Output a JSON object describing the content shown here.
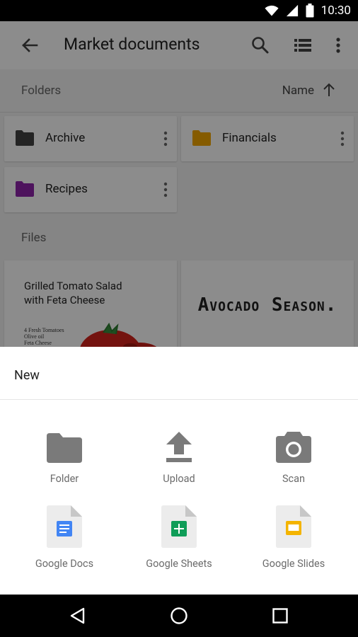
{
  "status_bar": {
    "time": "10:30"
  },
  "toolbar": {
    "title": "Market documents"
  },
  "folders_section": {
    "label": "Folders",
    "sort_label": "Name"
  },
  "folders": [
    {
      "name": "Archive",
      "color": "#424242"
    },
    {
      "name": "Financials",
      "color": "#F2A600"
    },
    {
      "name": "Recipes",
      "color": "#8E24AA"
    }
  ],
  "files_section": {
    "label": "Files"
  },
  "files": [
    {
      "title_line1": "Grilled Tomato Salad",
      "title_line2": "with Feta Cheese",
      "ingredients": [
        "4 Fresh Tomatoes",
        "Olive oil",
        "Feta Cheese"
      ]
    },
    {
      "title": "Avocado Season."
    }
  ],
  "sheet": {
    "title": "New",
    "items": [
      {
        "label": "Folder",
        "icon": "folder-icon"
      },
      {
        "label": "Upload",
        "icon": "upload-icon"
      },
      {
        "label": "Scan",
        "icon": "camera-icon"
      },
      {
        "label": "Google Docs",
        "icon": "google-docs-icon",
        "color": "#4285F4"
      },
      {
        "label": "Google Sheets",
        "icon": "google-sheets-icon",
        "color": "#0F9D58"
      },
      {
        "label": "Google Slides",
        "icon": "google-slides-icon",
        "color": "#F4B400"
      }
    ]
  }
}
